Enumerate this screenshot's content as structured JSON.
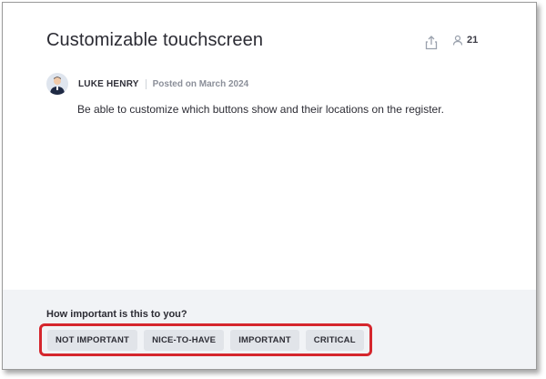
{
  "post": {
    "title": "Customizable touchscreen",
    "voter_count": "21",
    "author": "LUKE HENRY",
    "posted": "Posted on March 2024",
    "body": "Be able to customize which buttons show and their locations on the register."
  },
  "icons": {
    "share": "share-icon",
    "voters": "user-icon"
  },
  "importance": {
    "question": "How important is this to you?",
    "options": [
      {
        "label": "NOT IMPORTANT"
      },
      {
        "label": "NICE-TO-HAVE"
      },
      {
        "label": "IMPORTANT"
      },
      {
        "label": "CRITICAL"
      }
    ]
  },
  "colors": {
    "highlight": "#d5262d",
    "footer_bg": "#f1f3f6",
    "button_bg": "#e1e4e9"
  }
}
